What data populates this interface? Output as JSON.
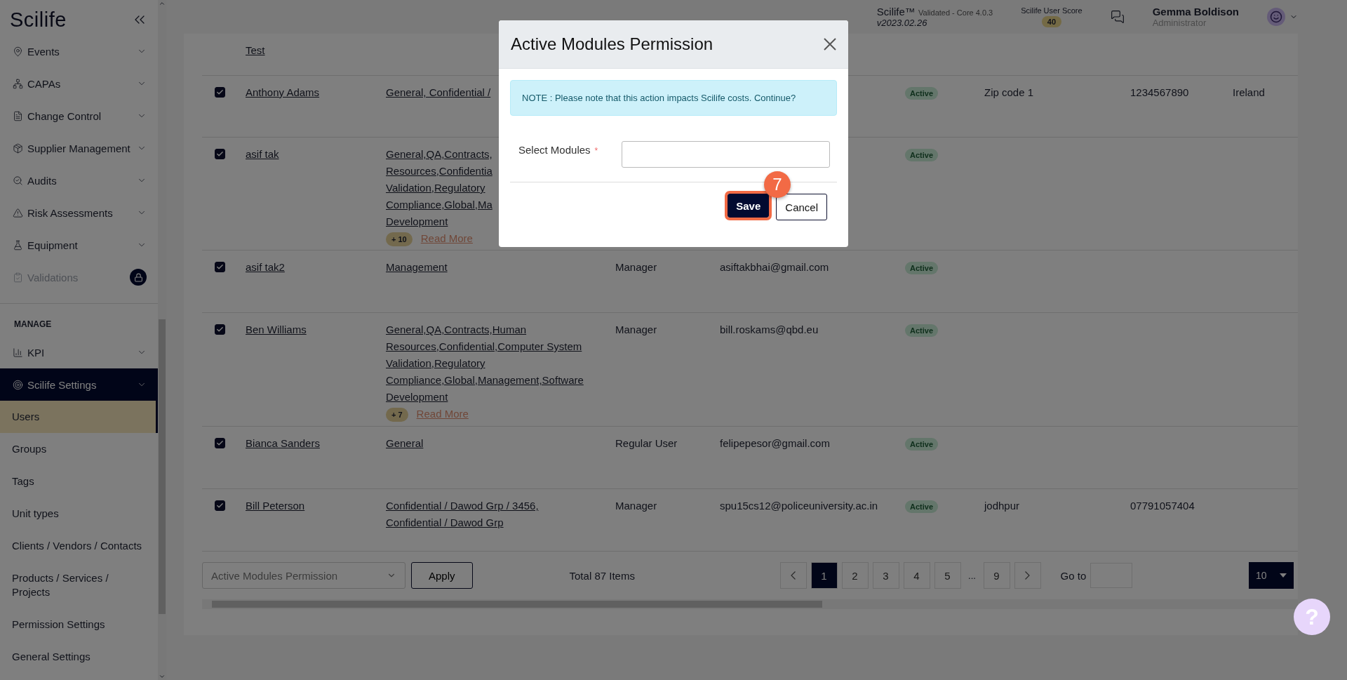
{
  "sidebar": {
    "logo": "Scilife",
    "items": [
      {
        "label": "Events",
        "locked": false
      },
      {
        "label": "CAPAs",
        "locked": false
      },
      {
        "label": "Change Control",
        "locked": false
      },
      {
        "label": "Supplier Management",
        "locked": false
      },
      {
        "label": "Audits",
        "locked": false
      },
      {
        "label": "Risk Assessments",
        "locked": false
      },
      {
        "label": "Equipment",
        "locked": false
      },
      {
        "label": "Validations",
        "locked": true
      }
    ],
    "section": "MANAGE",
    "manage_items": [
      {
        "label": "KPI",
        "expanded": false
      },
      {
        "label": "Scilife Settings",
        "expanded": true,
        "children": [
          {
            "label": "Users",
            "selected": true
          },
          {
            "label": "Groups",
            "selected": false
          },
          {
            "label": "Tags",
            "selected": false
          },
          {
            "label": "Unit types",
            "selected": false
          },
          {
            "label": "Clients / Vendors / Contacts",
            "selected": false
          },
          {
            "label": "Products / Services / Projects",
            "selected": false
          },
          {
            "label": "Permission Settings",
            "selected": false
          },
          {
            "label": "General Settings",
            "selected": false
          }
        ]
      }
    ]
  },
  "header": {
    "product": "Scilife™",
    "edition": "Validated - Core 4.0.3",
    "version": "v2023.02.26",
    "score_label": "Scilife User Score",
    "score": "40",
    "user_name": "Gemma Boldison",
    "user_role": "Administrator"
  },
  "table": {
    "partial_row": {
      "name": "Test"
    },
    "rows": [
      {
        "checked": true,
        "name": "Anthony Adams",
        "groups": [
          "General, Confidential /"
        ],
        "status": "Active",
        "zip": "Zip code 1",
        "phone": "1234567890",
        "country": "Ireland"
      },
      {
        "checked": true,
        "name": "asif tak",
        "groups": [
          "General,QA,Contracts,",
          "Resources,Confidentia",
          "Validation,Regulatory",
          "Compliance,Global,Ma",
          "Development"
        ],
        "more": "+ 10",
        "read_more": "Read More",
        "status": "Active"
      },
      {
        "checked": true,
        "name": "asif tak2",
        "groups": [
          "Management"
        ],
        "role": "Manager",
        "email": "asiftakbhai@gmail.com",
        "status": "Active"
      },
      {
        "checked": true,
        "name": "Ben Williams",
        "groups": [
          "General,QA,Contracts,Human",
          "Resources,Confidential,Computer System",
          "Validation,Regulatory",
          "Compliance,Global,Management,Software",
          "Development"
        ],
        "more": "+ 7",
        "read_more": "Read More",
        "role": "Manager",
        "email": "bill.roskams@qbd.eu",
        "status": "Active"
      },
      {
        "checked": true,
        "name": "Bianca Sanders",
        "groups": [
          "General"
        ],
        "role": "Regular User",
        "email": "felipepesor@gmail.com",
        "status": "Active"
      },
      {
        "checked": true,
        "name": "Bill Peterson",
        "groups": [
          "Confidential / Dawod Grp / 3456,",
          "Confidential / Dawod Grp"
        ],
        "role": "Manager",
        "email": "spu15cs12@policeuniversity.ac.in",
        "status": "Active",
        "zip": "jodhpur",
        "phone": "07791057404"
      }
    ]
  },
  "footer": {
    "bulk_action": "Active Modules Permission",
    "apply": "Apply",
    "total": "Total 87 Items",
    "pages": [
      {
        "kind": "page",
        "label": "1",
        "selected": true
      },
      {
        "kind": "page",
        "label": "2",
        "selected": false
      },
      {
        "kind": "page",
        "label": "3",
        "selected": false
      },
      {
        "kind": "page",
        "label": "4",
        "selected": false
      },
      {
        "kind": "page",
        "label": "5",
        "selected": false
      },
      {
        "kind": "ellipsis",
        "label": "..."
      },
      {
        "kind": "page",
        "label": "9",
        "selected": false
      }
    ],
    "goto_label": "Go to",
    "page_size": "10"
  },
  "modal": {
    "title": "Active Modules Permission",
    "note": "NOTE : Please note that this action impacts Scilife costs. Continue?",
    "field_label": "Select Modules",
    "required_mark": "*",
    "save": "Save",
    "cancel": "Cancel",
    "step_badge": "7"
  },
  "help": "?"
}
